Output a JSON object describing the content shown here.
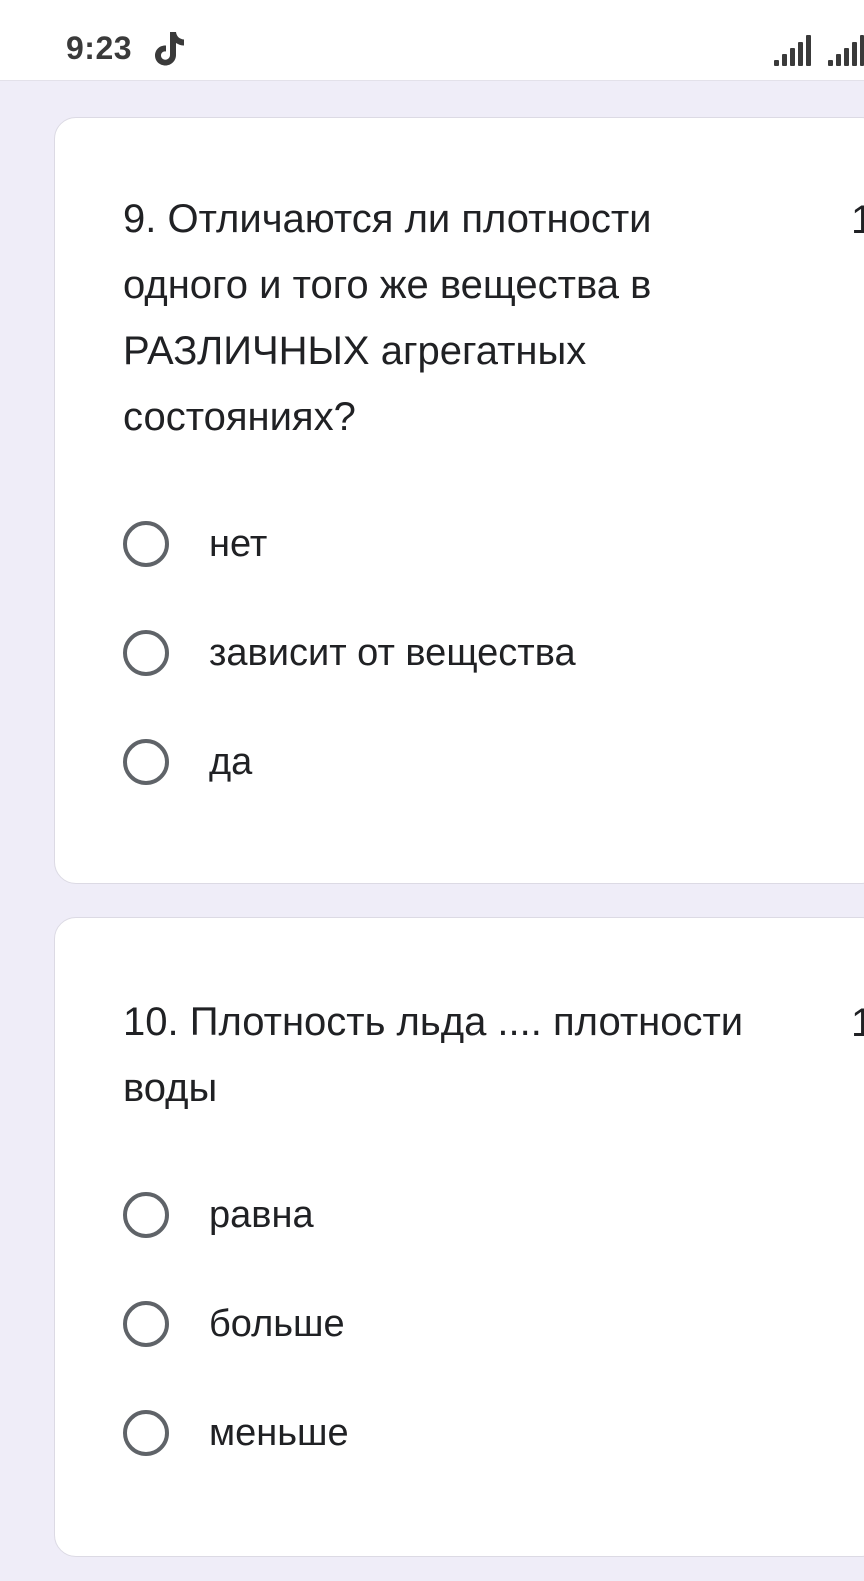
{
  "status_bar": {
    "time": "9:23",
    "icons": [
      "tiktok-icon",
      "signal-icon",
      "signal-icon"
    ]
  },
  "questions": [
    {
      "title": "9. Отличаются ли плотности одного и того же вещества в РАЗЛИЧНЫХ агрегатных состояниях?",
      "points": "1",
      "options": [
        "нет",
        "зависит от вещества",
        "да"
      ]
    },
    {
      "title": "10. Плотность льда .... плотности воды",
      "points": "1",
      "options": [
        "равна",
        "больше",
        "меньше"
      ]
    }
  ],
  "colors": {
    "page_background": "#efedf8",
    "card_background": "#ffffff",
    "radio_border": "#5f6368",
    "text": "#202124"
  }
}
